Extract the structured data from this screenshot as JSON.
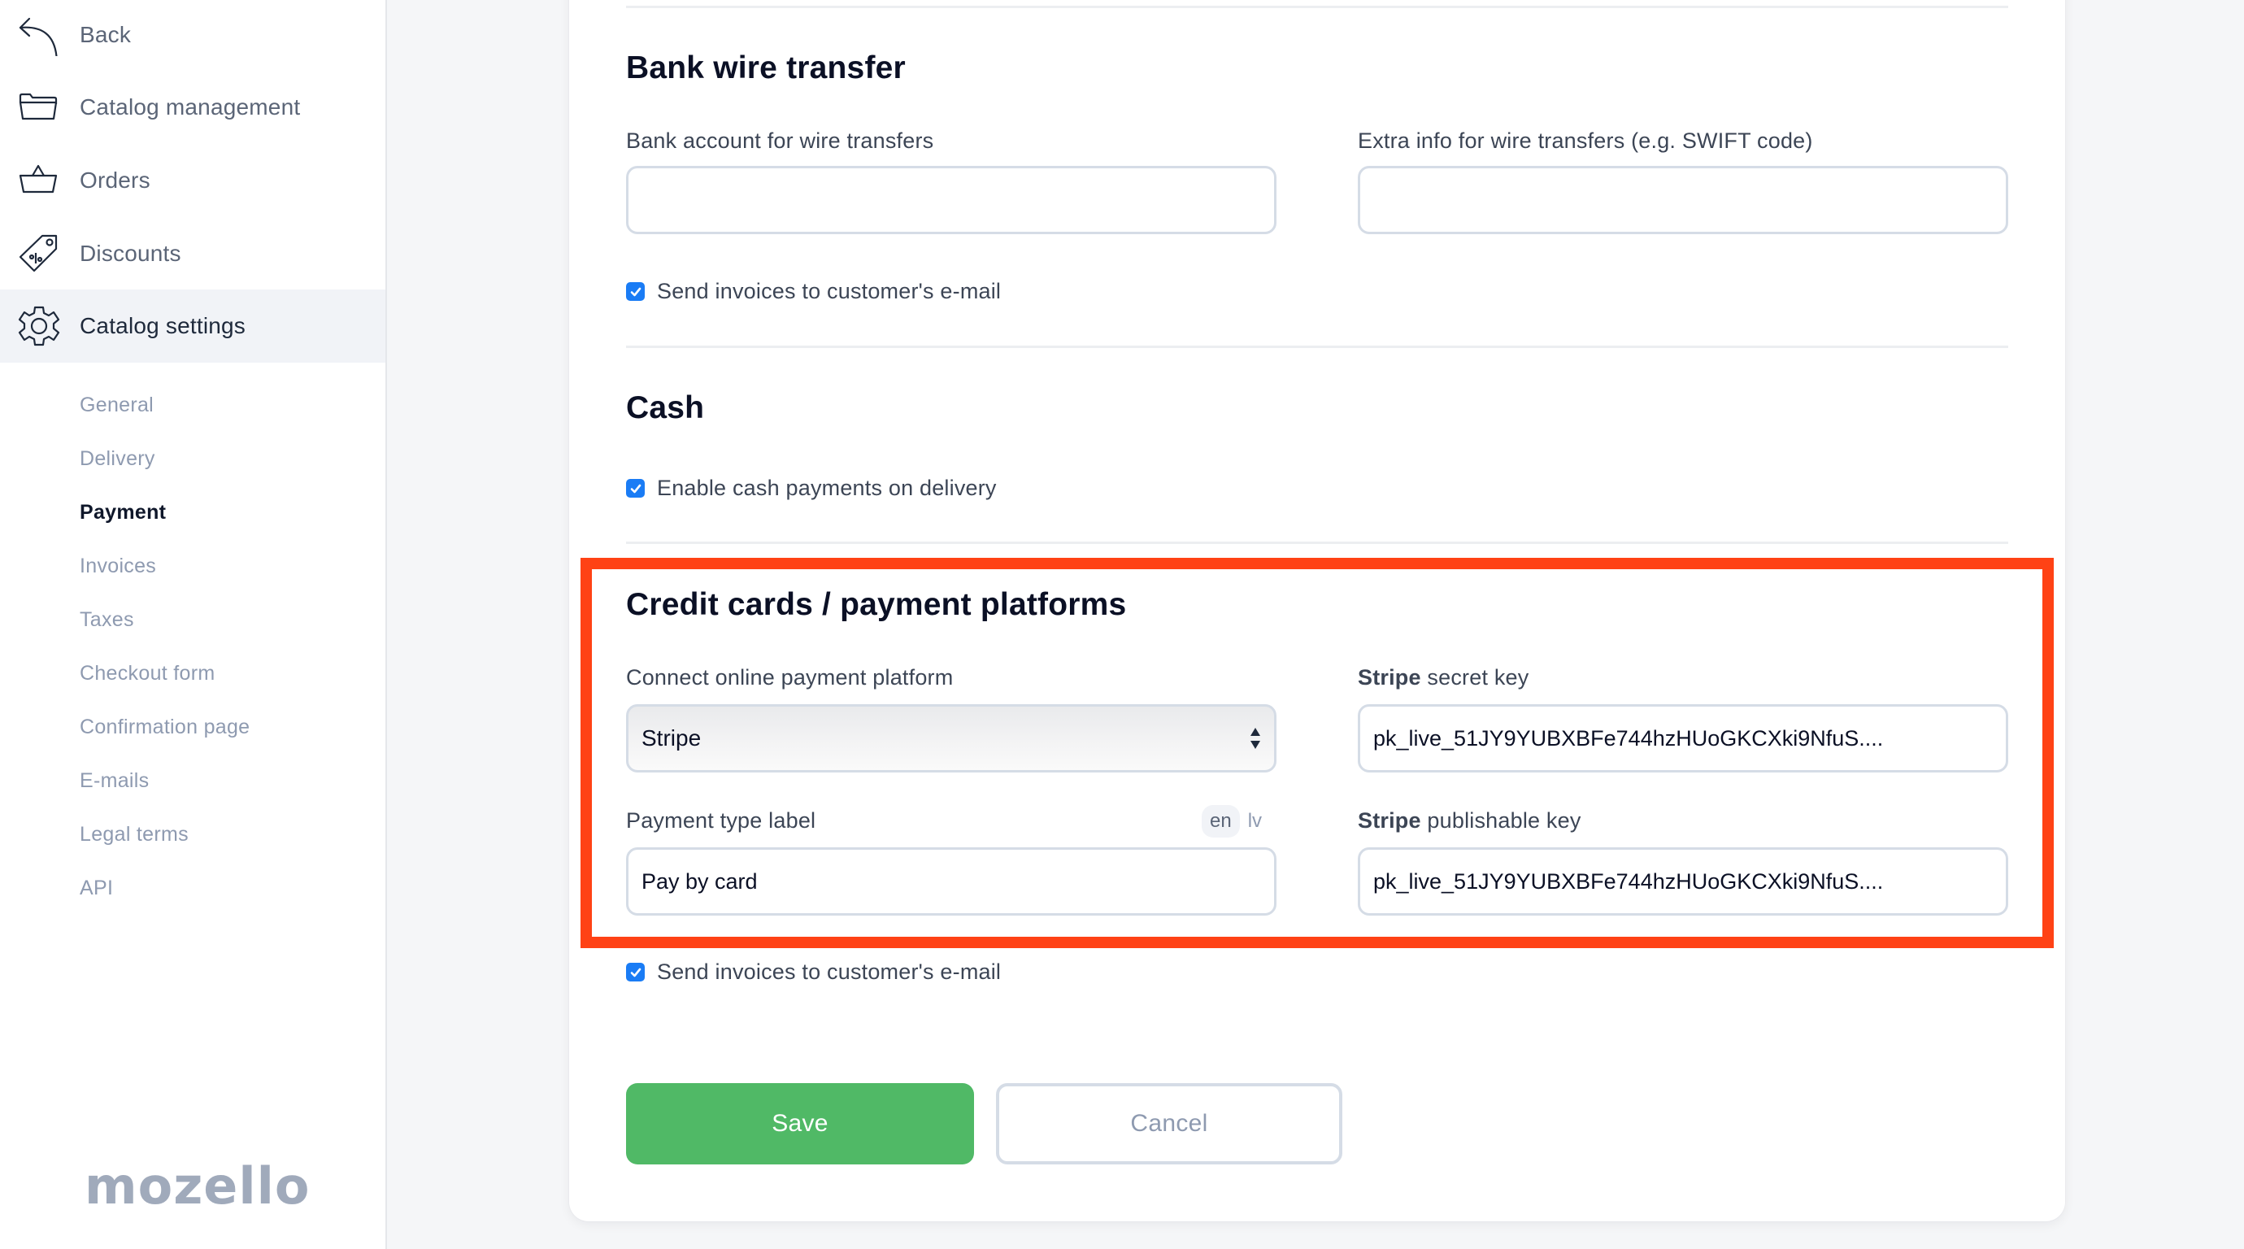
{
  "sidebar": {
    "nav": [
      {
        "label": "Back",
        "icon": "back-arrow-icon"
      },
      {
        "label": "Catalog management",
        "icon": "folder-icon"
      },
      {
        "label": "Orders",
        "icon": "basket-icon"
      },
      {
        "label": "Discounts",
        "icon": "discount-tag-icon"
      },
      {
        "label": "Catalog settings",
        "icon": "gear-icon",
        "active": true
      }
    ],
    "sub_items": [
      {
        "label": "General"
      },
      {
        "label": "Delivery"
      },
      {
        "label": "Payment",
        "active": true
      },
      {
        "label": "Invoices"
      },
      {
        "label": "Taxes"
      },
      {
        "label": "Checkout form"
      },
      {
        "label": "Confirmation page"
      },
      {
        "label": "E-mails"
      },
      {
        "label": "Legal terms"
      },
      {
        "label": "API"
      }
    ],
    "logo": "mozello"
  },
  "bank_wire": {
    "title": "Bank wire transfer",
    "account_label": "Bank account for wire transfers",
    "account_value": "",
    "extra_label": "Extra info for wire transfers (e.g. SWIFT code)",
    "extra_value": "",
    "send_invoices_label": "Send invoices to customer's e-mail",
    "send_invoices_checked": true
  },
  "cash": {
    "title": "Cash",
    "enable_label": "Enable cash payments on delivery",
    "enable_checked": true
  },
  "credit_cards": {
    "title": "Credit cards / payment platforms",
    "platform_label": "Connect online payment platform",
    "platform_value": "Stripe",
    "payment_type_label": "Payment type label",
    "payment_type_value": "Pay by card",
    "languages": [
      {
        "code": "en",
        "active": true
      },
      {
        "code": "lv",
        "active": false
      }
    ],
    "secret_key_label_bold": "Stripe",
    "secret_key_label_rest": " secret key",
    "secret_key_value": "pk_live_51JY9YUBXBFe744hzHUoGKCXki9NfuS....",
    "publishable_key_label_bold": "Stripe",
    "publishable_key_label_rest": " publishable key",
    "publishable_key_value": "pk_live_51JY9YUBXBFe744hzHUoGKCXki9NfuS....",
    "send_invoices_label": "Send invoices to customer's e-mail",
    "send_invoices_checked": true
  },
  "actions": {
    "save_label": "Save",
    "cancel_label": "Cancel"
  },
  "colors": {
    "highlight": "#ff4215",
    "save_button": "#50b966",
    "checkbox": "#1a7cf5"
  }
}
